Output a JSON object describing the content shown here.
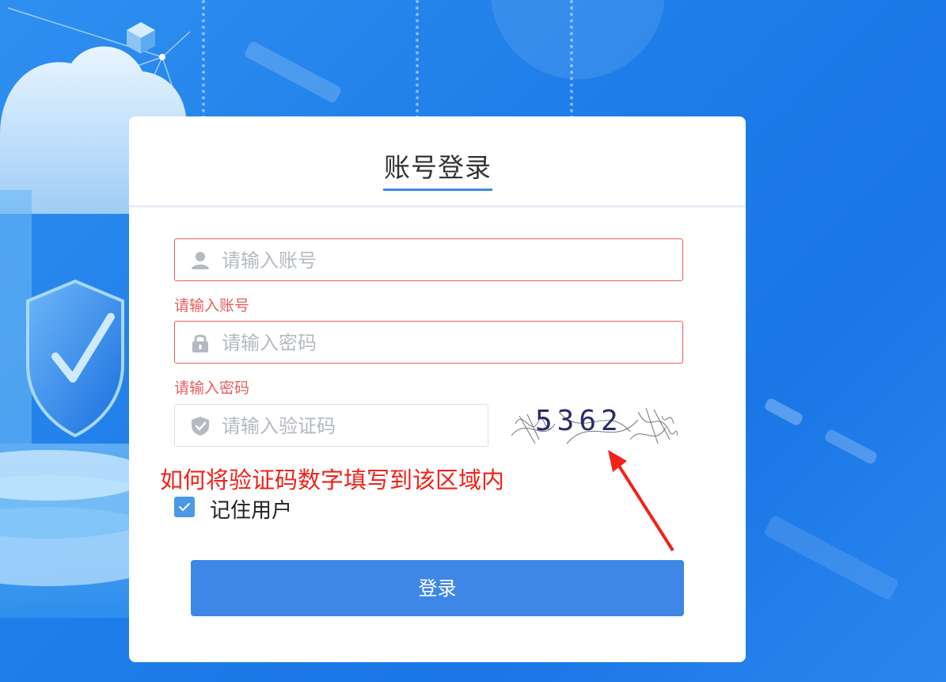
{
  "login": {
    "title": "账号登录",
    "account": {
      "placeholder": "请输入账号",
      "value": "",
      "error": "请输入账号"
    },
    "password": {
      "placeholder": "请输入密码",
      "value": "",
      "error": "请输入密码"
    },
    "captcha": {
      "placeholder": "请输入验证码",
      "value": "",
      "image_text": "5362"
    },
    "remember": {
      "label": "记住用户",
      "checked": true
    },
    "submit_label": "登录"
  },
  "annotation": {
    "text": "如何将验证码数字填写到该区域内",
    "color": "#f0221b"
  },
  "icons": {
    "account": "user-icon",
    "password": "lock-icon",
    "captcha": "shield-check-icon",
    "remember": "checkmark-icon"
  },
  "colors": {
    "accent": "#3f87e6",
    "error": "#e85c5c",
    "background": "#1f7ee9"
  }
}
